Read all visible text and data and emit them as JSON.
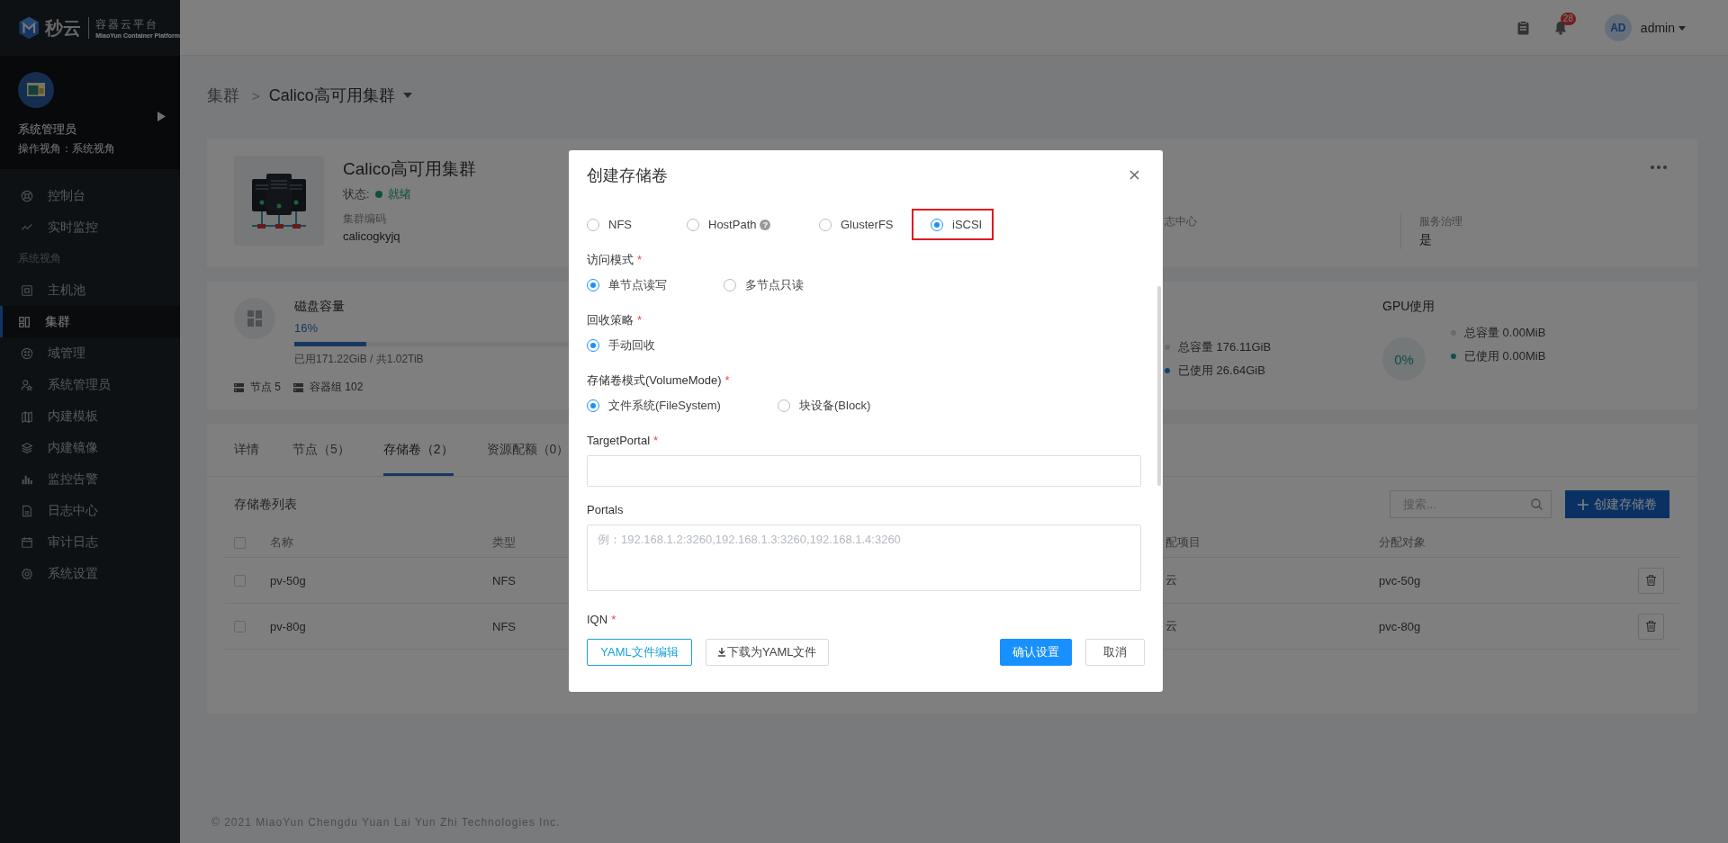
{
  "sidebar": {
    "brand": {
      "name": "秒云",
      "product": "容器云平台",
      "tagline": "MiaoYun Container Platform"
    },
    "user": {
      "name": "系统管理员",
      "view": "操作视角：系统视角"
    },
    "items": [
      {
        "kind": "item",
        "label": "控制台",
        "selected": false
      },
      {
        "kind": "item",
        "label": "实时监控",
        "selected": false
      },
      {
        "kind": "section",
        "label": "系统视角"
      },
      {
        "kind": "item",
        "label": "主机池",
        "selected": false
      },
      {
        "kind": "item",
        "label": "集群",
        "selected": true
      },
      {
        "kind": "item",
        "label": "域管理",
        "selected": false
      },
      {
        "kind": "item",
        "label": "系统管理员",
        "selected": false
      },
      {
        "kind": "item",
        "label": "内建模板",
        "selected": false
      },
      {
        "kind": "item",
        "label": "内建镜像",
        "selected": false
      },
      {
        "kind": "item",
        "label": "监控告警",
        "selected": false
      },
      {
        "kind": "item",
        "label": "日志中心",
        "selected": false
      },
      {
        "kind": "item",
        "label": "审计日志",
        "selected": false
      },
      {
        "kind": "item",
        "label": "系统设置",
        "selected": false
      }
    ]
  },
  "header": {
    "notifications": "28",
    "avatar": "AD",
    "user": "admin"
  },
  "breadcrumb": {
    "parent": "集群",
    "separator": ">",
    "current": "Calico高可用集群"
  },
  "cluster": {
    "name": "Calico高可用集群",
    "status_label": "状态:",
    "status": "就绪",
    "code_label": "集群编码",
    "code": "calicogkyjq",
    "info": [
      {
        "label": "志中心"
      },
      {
        "label": "服务治理",
        "value": "是"
      }
    ]
  },
  "capacity": {
    "title": "磁盘容量",
    "percent": "16%",
    "level": 0.16,
    "usage": "已用171.22GiB / 共1.02TiB",
    "stats": [
      "节点 5",
      "容器组 102"
    ],
    "memory_legend": [
      {
        "label": "总容量 176.11GiB",
        "color": "#6a6b6d"
      },
      {
        "label": "已使用 26.64GiB",
        "color": "#173f6b"
      }
    ],
    "gpu": {
      "title": "GPU使用",
      "percent": "0%",
      "legend": [
        {
          "label": "总容量 0.00MiB",
          "color": "#6a6b6d"
        },
        {
          "label": "已使用 0.00MiB",
          "color": "#0d514d"
        }
      ]
    }
  },
  "tabs": [
    {
      "label": "详情",
      "selected": false
    },
    {
      "label": "节点（5）",
      "selected": false
    },
    {
      "label": "存储卷（2）",
      "selected": true
    },
    {
      "label": "资源配额（0）",
      "selected": false
    }
  ],
  "volumes": {
    "title": "存储卷列表",
    "search": {
      "placeholder": "搜索..."
    },
    "create_button": "创建存储卷",
    "all_checked": false,
    "columns": [
      "名称",
      "类型",
      "配项目",
      "分配对象"
    ],
    "rows": [
      {
        "checked": false,
        "cells": [
          "pv-50g",
          "NFS",
          "云",
          "pvc-50g"
        ]
      },
      {
        "checked": false,
        "cells": [
          "pv-80g",
          "NFS",
          "云",
          "pvc-80g"
        ]
      }
    ]
  },
  "footer": "© 2021 MiaoYun Chengdu Yuan Lai Yun Zhi Technologies Inc.",
  "dialog": {
    "title": "创建存储卷",
    "groups": [
      {
        "kind": "radio",
        "options": [
          {
            "label": "NFS",
            "selected": false,
            "highlighted": false
          },
          {
            "label": "HostPath",
            "help": "?",
            "selected": false,
            "highlighted": false
          },
          {
            "label": "GlusterFS",
            "selected": false,
            "highlighted": false
          },
          {
            "label": "iSCSI",
            "selected": true,
            "highlighted": true
          }
        ]
      },
      {
        "kind": "radio",
        "label": "访问模式",
        "mark": "*",
        "options": [
          {
            "label": "单节点读写",
            "selected": true,
            "highlighted": false
          },
          {
            "label": "多节点只读",
            "selected": false,
            "highlighted": false
          }
        ]
      },
      {
        "kind": "radio",
        "label": "回收策略",
        "mark": "*",
        "options": [
          {
            "label": "手动回收",
            "selected": true,
            "highlighted": false
          }
        ]
      },
      {
        "kind": "radio",
        "label": "存储卷模式(VolumeMode)",
        "mark": "*",
        "options": [
          {
            "label": "文件系统(FileSystem)",
            "selected": true,
            "highlighted": false
          },
          {
            "label": "块设备(Block)",
            "selected": false,
            "highlighted": false
          }
        ]
      },
      {
        "kind": "input",
        "label": "TargetPortal",
        "mark": "*"
      },
      {
        "kind": "textarea",
        "label": "Portals",
        "placeholder": "例：192.168.1.2:3260,192.168.1.3:3260,192.168.1.4:3260"
      },
      {
        "kind": "caption",
        "label": "IQN",
        "mark": "*"
      }
    ],
    "buttons": [
      {
        "kind": "outline",
        "label": "YAML文件编辑"
      },
      {
        "kind": "download",
        "label": "下载为YAML文件"
      },
      {
        "kind": "primary",
        "label": "确认设置"
      },
      {
        "kind": "default",
        "label": "取消"
      }
    ]
  }
}
